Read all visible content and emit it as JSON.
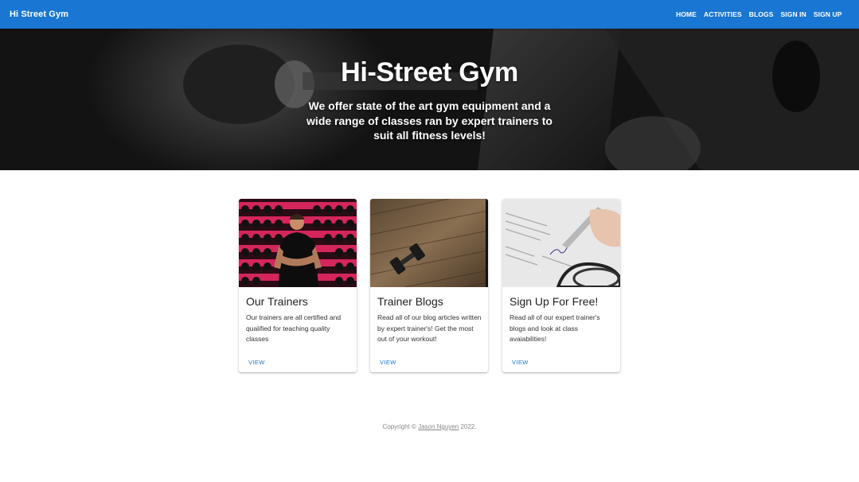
{
  "appbar": {
    "brand": "Hi Street Gym",
    "nav": [
      "HOME",
      "ACTIVITIES",
      "BLOGS",
      "SIGN IN",
      "SIGN UP"
    ],
    "color": "#1976d2"
  },
  "hero": {
    "title": "Hi-Street Gym",
    "subtitle": "We offer state of the art gym equipment and a wide range of classes ran by expert trainers to suit all fitness levels!"
  },
  "cards": [
    {
      "title": "Our Trainers",
      "text": "Our trainers are all certified and qualified for teaching quality classes",
      "button": "VIEW",
      "image": "trainer-photo"
    },
    {
      "title": "Trainer Blogs",
      "text": "Read all of our blog articles written by expert trainer's! Get the most out of your workout!",
      "button": "VIEW",
      "image": "dumbbell-photo"
    },
    {
      "title": "Sign Up For Free!",
      "text": "Read all of our expert trainer's blogs and look at class avaiabilities!",
      "button": "VIEW",
      "image": "signing-document-photo"
    }
  ],
  "footer": {
    "prefix": "Copyright © ",
    "author": "Jason Nguyen",
    "suffix": " 2022."
  }
}
